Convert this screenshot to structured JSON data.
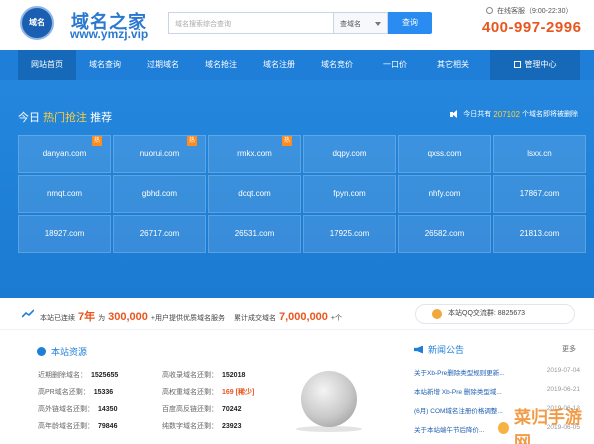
{
  "header": {
    "logo_badge": "域名",
    "logo_title": "域名之家",
    "logo_url": "www.ymzj.vip",
    "search_placeholder": "域名搜索综合查询",
    "search_select": "查域名",
    "search_button": "查询",
    "consult_text": "在线客服（9:00-22:30）",
    "phone": "400-997-2996"
  },
  "nav": {
    "items": [
      "网站首页",
      "域名查询",
      "过期域名",
      "域名抢注",
      "域名注册",
      "域名竞价",
      "一口价",
      "其它相关"
    ],
    "mgmt": "管理中心"
  },
  "hot": {
    "title_prefix": "今日",
    "title_highlight": "热门抢注",
    "title_suffix": "推荐",
    "count_prefix": "今日共有",
    "count": "207102",
    "count_suffix": "个域名即将被删除",
    "hot_tag": "热",
    "domains": [
      {
        "name": "danyan.com",
        "hot": true
      },
      {
        "name": "nuorui.com",
        "hot": true
      },
      {
        "name": "rmkx.com",
        "hot": true
      },
      {
        "name": "dqpy.com",
        "hot": false
      },
      {
        "name": "qxss.com",
        "hot": false
      },
      {
        "name": "lsxx.cn",
        "hot": false
      },
      {
        "name": "nmqt.com",
        "hot": false
      },
      {
        "name": "gbhd.com",
        "hot": false
      },
      {
        "name": "dcqt.com",
        "hot": false
      },
      {
        "name": "fpyn.com",
        "hot": false
      },
      {
        "name": "nhfy.com",
        "hot": false
      },
      {
        "name": "17867.com",
        "hot": false
      },
      {
        "name": "18927.com",
        "hot": false
      },
      {
        "name": "26717.com",
        "hot": false
      },
      {
        "name": "26531.com",
        "hot": false
      },
      {
        "name": "17925.com",
        "hot": false
      },
      {
        "name": "26582.com",
        "hot": false
      },
      {
        "name": "21813.com",
        "hot": false
      }
    ]
  },
  "stats": {
    "t1": "本站已连续",
    "years": "7年",
    "t2": "为",
    "users": "300,000",
    "t3": "+用户提供优质域名服务",
    "t4": "累计成交域名",
    "deals": "7,000,000",
    "t5": "+个",
    "qq": "本站QQ交流群: 8825673"
  },
  "resources": {
    "title": "本站资源",
    "rows": [
      {
        "label": "近期删除域名：",
        "value": "1525655",
        "orange": false
      },
      {
        "label": "高收录域名还剩：",
        "value": "152018",
        "orange": false
      },
      {
        "label": "高PR域名还剩：",
        "value": "15336",
        "orange": false
      },
      {
        "label": "高权重域名还剩：",
        "value": "169 [稀少]",
        "orange": true
      },
      {
        "label": "高外链域名还剩：",
        "value": "14350",
        "orange": false
      },
      {
        "label": "百度高反链还剩：",
        "value": "70242",
        "orange": false
      },
      {
        "label": "高年龄域名还剩：",
        "value": "79846",
        "orange": false
      },
      {
        "label": "纯数字域名还剩：",
        "value": "23923",
        "orange": false
      }
    ]
  },
  "news": {
    "title": "新闻公告",
    "more": "更多",
    "items": [
      {
        "title": "关于Xb-Pre删除类型规则更新...",
        "date": "2019-07-04"
      },
      {
        "title": "本站新增 Xb-Pre 删除类型域...",
        "date": "2019-06-21"
      },
      {
        "title": "(6月) COM域名注册价格调整...",
        "date": "2019-06-13"
      },
      {
        "title": "关于本站端午节后降价...",
        "date": "2019-06-05"
      }
    ]
  },
  "watermark": "菜归手游网",
  "colors": {
    "primary": "#1f7fd8",
    "accent": "#e8561e",
    "highlight": "#ffcf3c"
  }
}
